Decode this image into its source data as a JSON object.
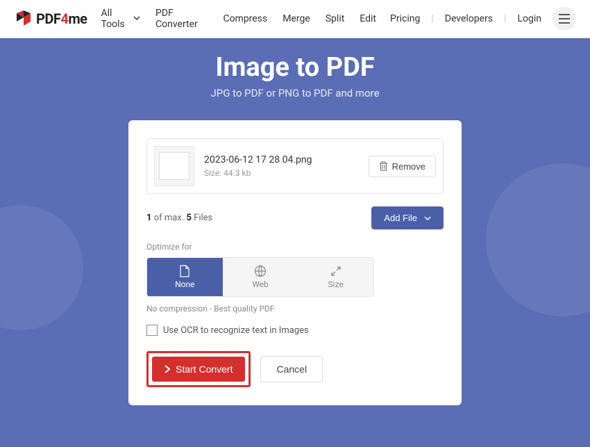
{
  "header": {
    "logo_text": "PDF4me",
    "nav": {
      "all_tools": "All Tools",
      "converter": "PDF Converter",
      "compress": "Compress",
      "merge": "Merge",
      "split": "Split",
      "edit": "Edit"
    },
    "right": {
      "pricing": "Pricing",
      "developers": "Developers",
      "login": "Login"
    }
  },
  "hero": {
    "title": "Image to PDF",
    "subtitle": "JPG to PDF or PNG to PDF and more"
  },
  "file": {
    "name": "2023-06-12 17 28 04.png",
    "size": "Size: 44.3 kb",
    "remove": "Remove"
  },
  "counts": {
    "current": "1",
    "mid": " of max. ",
    "max": "5",
    "suffix": " Files",
    "add_file": "Add File"
  },
  "optimize": {
    "label": "Optimize for",
    "none": "None",
    "web": "Web",
    "size": "Size",
    "hint": "No compression - Best quality PDF"
  },
  "ocr": {
    "label": "Use OCR to recognize text in Images"
  },
  "actions": {
    "start": "Start Convert",
    "cancel": "Cancel"
  }
}
